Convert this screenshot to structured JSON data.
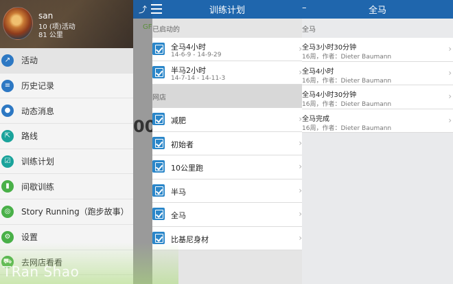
{
  "profile": {
    "name": "san",
    "activities": "10 (项)活动",
    "distance": "81 公里"
  },
  "menu": [
    {
      "label": "活动",
      "icon": "activity-chart-icon",
      "color": "blue",
      "selected": true
    },
    {
      "label": "历史记录",
      "icon": "list-icon",
      "color": "blue"
    },
    {
      "label": "动态消息",
      "icon": "people-icon",
      "color": "blue"
    },
    {
      "label": "路线",
      "icon": "signpost-icon",
      "color": "teal"
    },
    {
      "label": "训练计划",
      "icon": "checkbox-icon",
      "color": "teal"
    },
    {
      "label": "间歇训练",
      "icon": "bar-chart-icon",
      "color": "green"
    },
    {
      "label": "Story Running（跑步故事）",
      "icon": "headphones-icon",
      "color": "green"
    },
    {
      "label": "设置",
      "icon": "gear-icon",
      "color": "green"
    },
    {
      "label": "去网店看看",
      "icon": "cart-icon",
      "color": "green"
    }
  ],
  "watermark": "TRan Shao",
  "behind": {
    "big_text": "00",
    "small_text": "GF"
  },
  "plans": {
    "title": "训练计划",
    "started_header": "已启动的",
    "started": [
      {
        "title": "全马4小时",
        "dates": "14-6-9 - 14-9-29"
      },
      {
        "title": "半马2小时",
        "dates": "14-7-14 - 14-11-3"
      }
    ],
    "shop_header": "网店",
    "shop": [
      "减肥",
      "初始者",
      "10公里跑",
      "半马",
      "全马",
      "比基尼身材"
    ]
  },
  "marathon": {
    "title": "全马",
    "back": "–",
    "section": "全马",
    "items": [
      {
        "title": "全马3小时30分钟",
        "meta": "16周，作者：Dieter Baumann"
      },
      {
        "title": "全马4小时",
        "meta": "16周，作者：Dieter Baumann"
      },
      {
        "title": "全马4小时30分钟",
        "meta": "16周，作者：Dieter Baumann"
      },
      {
        "title": "全马完成",
        "meta": "16周，作者：Dieter Baumann"
      }
    ]
  },
  "colors": {
    "header_blue": "#1f66ad",
    "checkbox_blue": "#2a86c9",
    "icon_blue": "#2d78c3",
    "icon_teal": "#1aa39b",
    "icon_green": "#49b048"
  }
}
